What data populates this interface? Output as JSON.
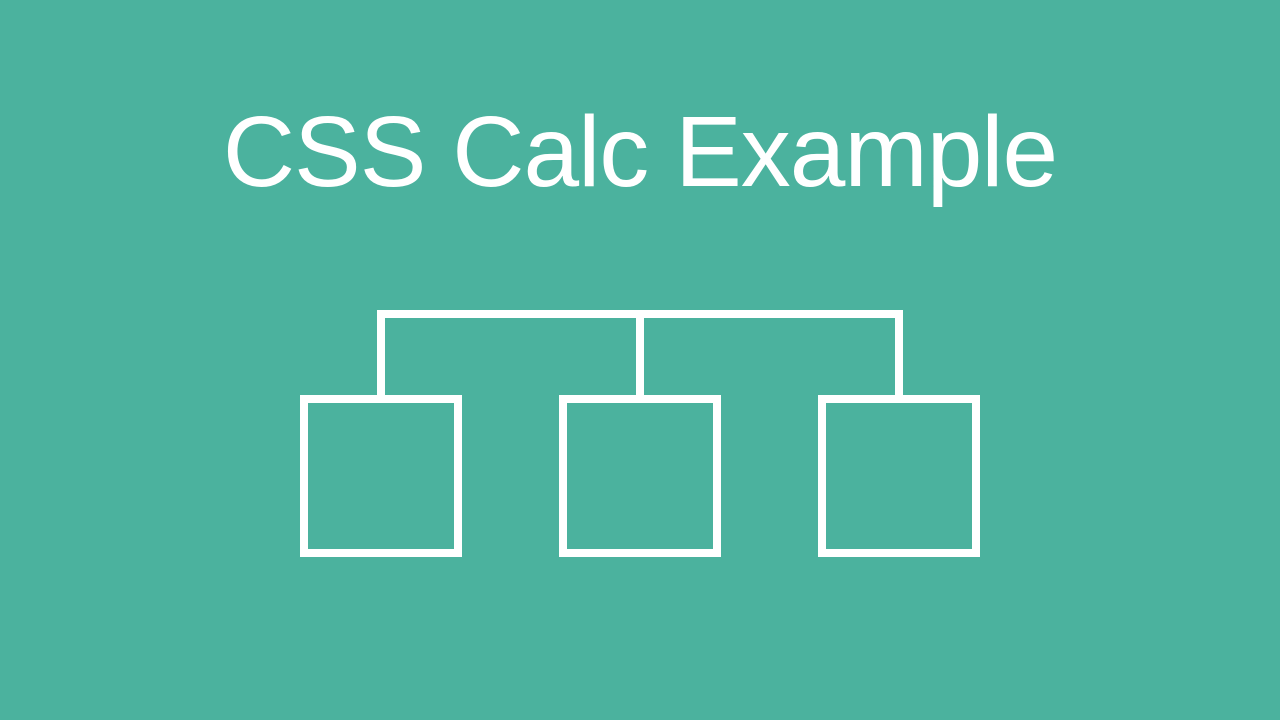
{
  "title": "CSS Calc Example",
  "diagram": {
    "type": "tree",
    "description": "Hierarchical tree diagram with one parent connector branching to three child boxes",
    "colors": {
      "background": "#4BB29E",
      "stroke": "#FFFFFF"
    },
    "nodes": {
      "count": 3,
      "shape": "square"
    }
  }
}
